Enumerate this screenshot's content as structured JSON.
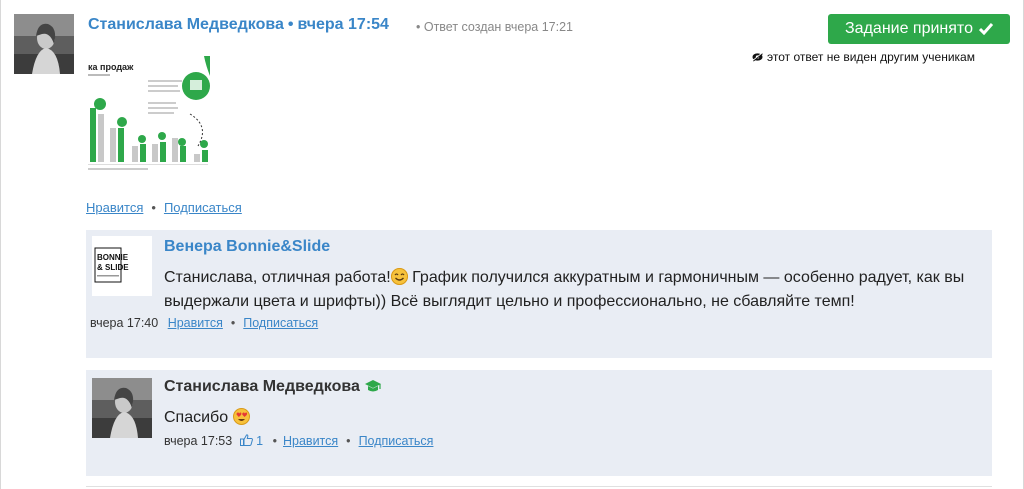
{
  "post": {
    "author": "Станислава Медведкова",
    "time": "вчера 17:54",
    "created": "• Ответ создан вчера 17:21",
    "accepted_label": "Задание принято",
    "hidden_note": "этот ответ не виден другим ученикам",
    "thumb_title": "ка продаж",
    "like": "Нравится",
    "subscribe": "Подписаться"
  },
  "replies": [
    {
      "author": "Венера Bonnie&Slide",
      "logo_line1": "BONNIE",
      "logo_line2": "& SLIDE",
      "text_a": "Станислава, отличная работа!",
      "text_b": " График получился аккуратным и гармоничным — особенно радует, как вы выдержали цвета и шрифты)) Всё выглядит цельно и профессионально, не сбавляйте темп!",
      "time": "вчера 17:40",
      "like": "Нравится",
      "subscribe": "Подписаться"
    },
    {
      "author": "Станислава Медведкова",
      "text": "Спасибо",
      "time": "вчера 17:53",
      "likes_count": "1",
      "like": "Нравится",
      "subscribe": "Подписаться"
    }
  ],
  "colors": {
    "link": "#3a86c8",
    "accept": "#2ea84a",
    "reply_bg": "#e9edf4"
  }
}
